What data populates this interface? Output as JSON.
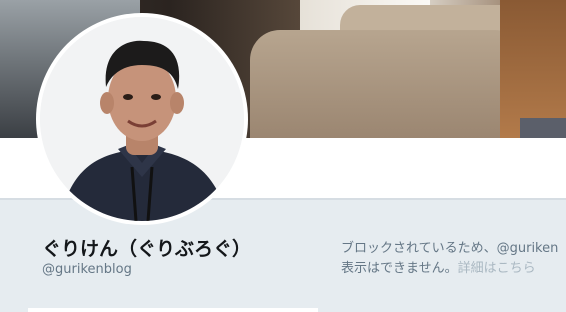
{
  "profile": {
    "display_name": "ぐりけん（ぐりぶろぐ）",
    "handle": "@gurikenblog"
  },
  "blocked_notice": {
    "line1": "ブロックされているため、@guriken",
    "line2": "表示はできません。",
    "details_link": "詳細はこちら"
  },
  "icons": {
    "avatar": "profile-photo",
    "header": "header-photo"
  }
}
